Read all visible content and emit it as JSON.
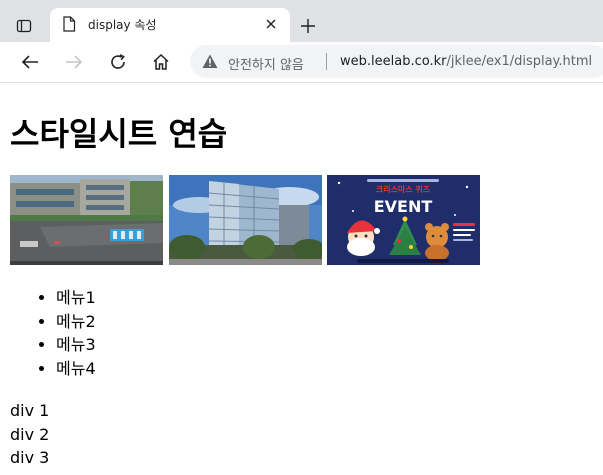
{
  "browser": {
    "tab_title": "display 속성",
    "security_label": "안전하지 않음",
    "url_host": "web.leelab.co.kr",
    "url_path": "/jklee/ex1/display.html"
  },
  "page": {
    "title": "스타일시트 연습",
    "images": [
      {
        "name": "campus-courtyard-photo"
      },
      {
        "name": "office-building-photo"
      },
      {
        "name": "christmas-event-banner",
        "banner_title": "크리스마스 퀴즈",
        "banner_event": "EVENT"
      }
    ],
    "menu_items": [
      "메뉴1",
      "메뉴2",
      "메뉴3",
      "메뉴4"
    ],
    "divs": [
      "div 1",
      "div 2",
      "div 3"
    ]
  },
  "colors": {
    "tabbar_bg": "#dfe1e5",
    "address_bg": "#f1f3f4",
    "event_bg": "#1f2d6b",
    "event_accent": "#e8323c"
  }
}
